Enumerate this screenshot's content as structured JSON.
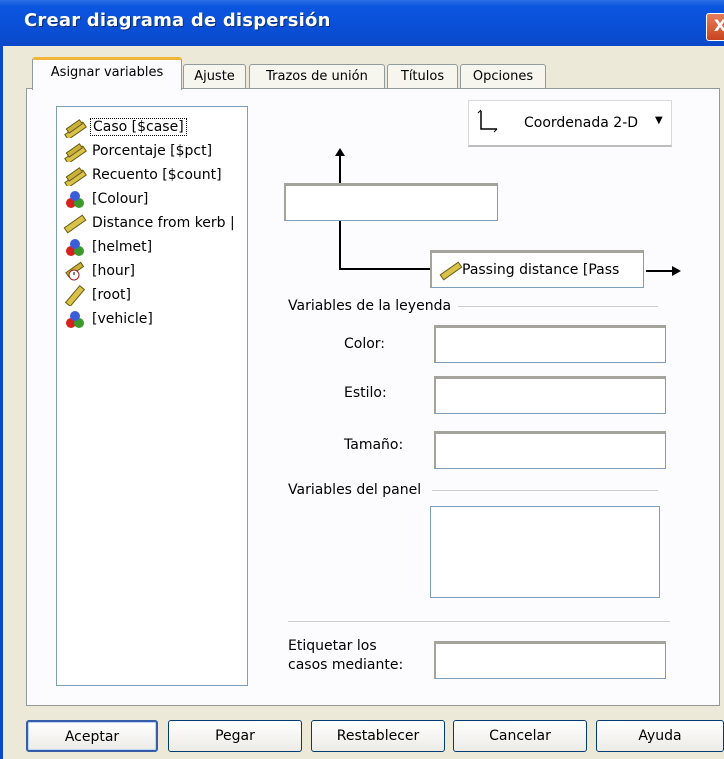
{
  "window": {
    "title": "Crear diagrama de dispersión",
    "close_glyph": "X"
  },
  "tabs": [
    {
      "label": "Asignar variables",
      "active": true
    },
    {
      "label": "Ajuste"
    },
    {
      "label": "Trazos de unión"
    },
    {
      "label": "Títulos"
    },
    {
      "label": "Opciones"
    }
  ],
  "variables": [
    {
      "label": "Caso [$case]",
      "icon": "scale-ruler-icon"
    },
    {
      "label": "Porcentaje [$pct]",
      "icon": "scale-ruler-icon"
    },
    {
      "label": "Recuento [$count]",
      "icon": "scale-ruler-icon"
    },
    {
      "label": "[Colour]",
      "icon": "nominal-icon"
    },
    {
      "label": "Distance from kerb |",
      "icon": "scale-ruler-icon"
    },
    {
      "label": "[helmet]",
      "icon": "nominal-icon"
    },
    {
      "label": "[hour]",
      "icon": "time-scale-icon"
    },
    {
      "label": "[root]",
      "icon": "scale-ruler-icon"
    },
    {
      "label": "[vehicle]",
      "icon": "nominal-icon"
    }
  ],
  "coordinate": {
    "label": "Coordenada 2-D"
  },
  "x_axis": {
    "value": "Passing distance [Pass"
  },
  "legend": {
    "heading": "Variables de la leyenda",
    "color_label": "Color:",
    "style_label": "Estilo:",
    "size_label": "Tamaño:"
  },
  "panel": {
    "heading": "Variables del panel"
  },
  "label_cases": {
    "line1": "Etiquetar los",
    "line2": "casos mediante:"
  },
  "buttons": {
    "accept": "Aceptar",
    "paste": "Pegar",
    "reset": "Restablecer",
    "cancel": "Cancelar",
    "help": "Ayuda"
  }
}
